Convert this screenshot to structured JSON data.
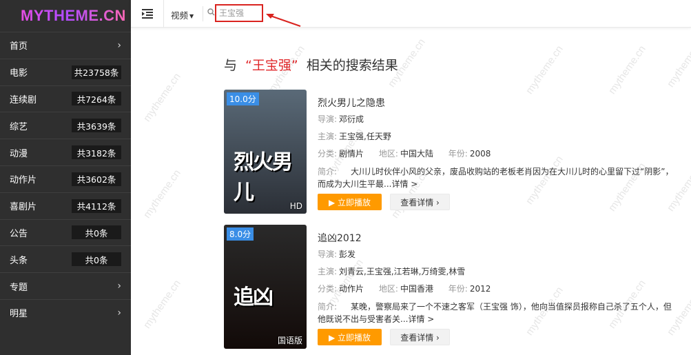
{
  "logo": "MYTHEME.CN",
  "sidebar": {
    "items": [
      {
        "label": "首页",
        "count": null,
        "arrow": true
      },
      {
        "label": "电影",
        "count": "共23758条"
      },
      {
        "label": "连续剧",
        "count": "共7264条"
      },
      {
        "label": "综艺",
        "count": "共3639条"
      },
      {
        "label": "动漫",
        "count": "共3182条"
      },
      {
        "label": "动作片",
        "count": "共3602条"
      },
      {
        "label": "喜剧片",
        "count": "共4112条"
      },
      {
        "label": "公告",
        "count": "共0条"
      },
      {
        "label": "头条",
        "count": "共0条"
      },
      {
        "label": "专题",
        "count": null,
        "arrow": true
      },
      {
        "label": "明星",
        "count": null,
        "arrow": true
      }
    ]
  },
  "topbar": {
    "type_label": "视频",
    "search_value": "王宝强"
  },
  "watermark_text": "mytheme.cn",
  "results": {
    "prefix": "与",
    "keyword": "“王宝强”",
    "suffix": "相关的搜索结果"
  },
  "movies": [
    {
      "score": "10.0分",
      "tag": "HD",
      "title": "烈火男儿之隐患",
      "director_label": "导演:",
      "director": "邓衍成",
      "cast_label": "主演:",
      "cast": "王宝强,任天野",
      "category_label": "分类:",
      "category": "剧情片",
      "region_label": "地区:",
      "region": "中国大陆",
      "year_label": "年份:",
      "year": "2008",
      "intro_label": "简介:",
      "intro": "大川儿时伙伴小风的父亲，废品收购站的老板老肖因为在大川儿时的心里留下过“阴影”，而成为大川生平最...详情 >",
      "poster_art": "烈火男儿",
      "poster_colors": [
        "#5a6a78",
        "#2b2f36"
      ]
    },
    {
      "score": "8.0分",
      "tag": "国语版",
      "title": "追凶2012",
      "director_label": "导演:",
      "director": "彭发",
      "cast_label": "主演:",
      "cast": "刘青云,王宝强,江若琳,万绮雯,林雪",
      "category_label": "分类:",
      "category": "动作片",
      "region_label": "地区:",
      "region": "中国香港",
      "year_label": "年份:",
      "year": "2012",
      "intro_label": "简介:",
      "intro": "某晚，警察局来了一个不速之客军（王宝强 饰），他向当值探员报称自己杀了五个人，但他既说不出与受害者关...详情 >",
      "poster_art": "追凶",
      "poster_colors": [
        "#2a2a2a",
        "#120a08"
      ]
    }
  ],
  "buttons": {
    "play": "▶ 立即播放",
    "detail": "查看详情 ›"
  },
  "colors": {
    "sidebar_bg": "#2f2f2f",
    "accent_orange": "#ff9a00",
    "keyword_red": "#e0282b",
    "score_blue": "#3a8ee6"
  }
}
